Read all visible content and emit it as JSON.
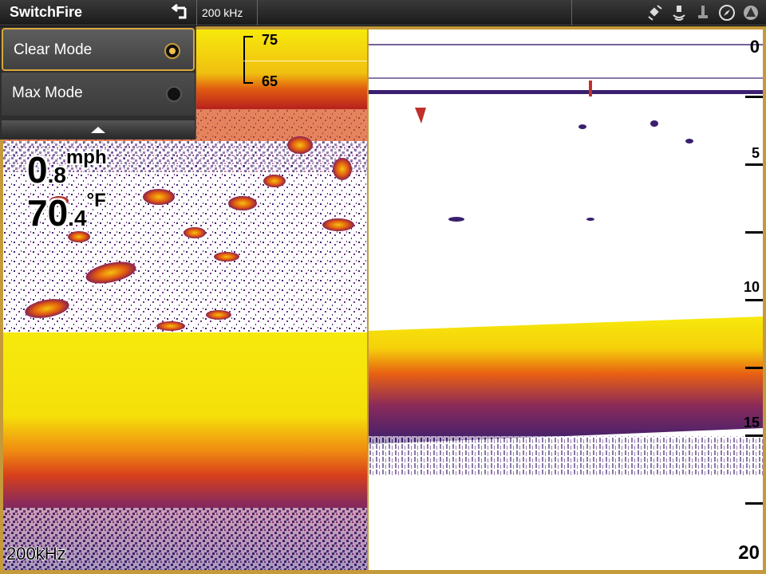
{
  "topbar": {
    "title": "SwitchFire",
    "back_icon": "return-arrow-icon",
    "frequency": "200 kHz",
    "status_icons": [
      "gps-satellite-icon",
      "sonar-transducer-icon",
      "depth-sounder-icon",
      "compass-icon",
      "nav-triangle-icon"
    ]
  },
  "menu": {
    "items": [
      {
        "label": "Clear Mode",
        "selected": true
      },
      {
        "label": "Max Mode",
        "selected": false
      }
    ],
    "collapse_icon": "chevron-up-icon"
  },
  "overlay": {
    "speed_int": "0",
    "speed_dec": ".8",
    "speed_unit": "mph",
    "temp_int": "70",
    "temp_dec": ".4",
    "temp_unit": "°F",
    "frequency": "200kHz"
  },
  "zoom": {
    "top": "75",
    "bottom": "65"
  },
  "depth_scale": [
    "0",
    "5",
    "10",
    "15",
    "20"
  ],
  "colors": {
    "accent": "#d9a63c",
    "sonar_bottom": "#f5e60a",
    "sonar_mid": "#e05a10",
    "sonar_deep": "#3a1f6e"
  }
}
